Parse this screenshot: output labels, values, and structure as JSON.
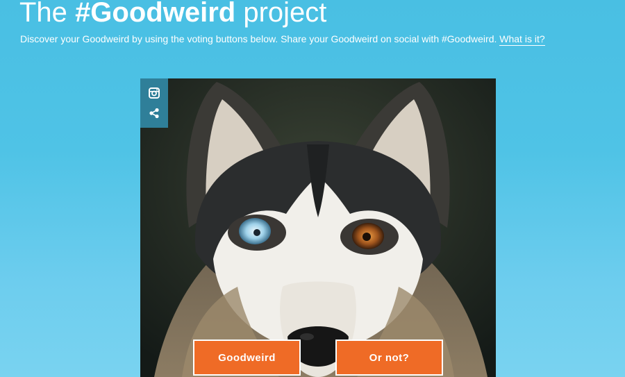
{
  "header": {
    "title_prefix": "The",
    "title_hashtag": "#Goodweird",
    "title_suffix": "project",
    "description": "Discover your Goodweird by using the voting buttons below. Share your Goodweird on social with #Goodweird.",
    "what_link": "What is it?"
  },
  "card": {
    "icons": [
      "instagram-icon",
      "share-icon"
    ]
  },
  "vote": {
    "yes_label": "Goodweird",
    "no_label": "Or not?"
  },
  "colors": {
    "background": "#4fc3e6",
    "icon_bar": "#2f7f99",
    "button": "#ef6b26",
    "button_border": "#ffffff"
  }
}
